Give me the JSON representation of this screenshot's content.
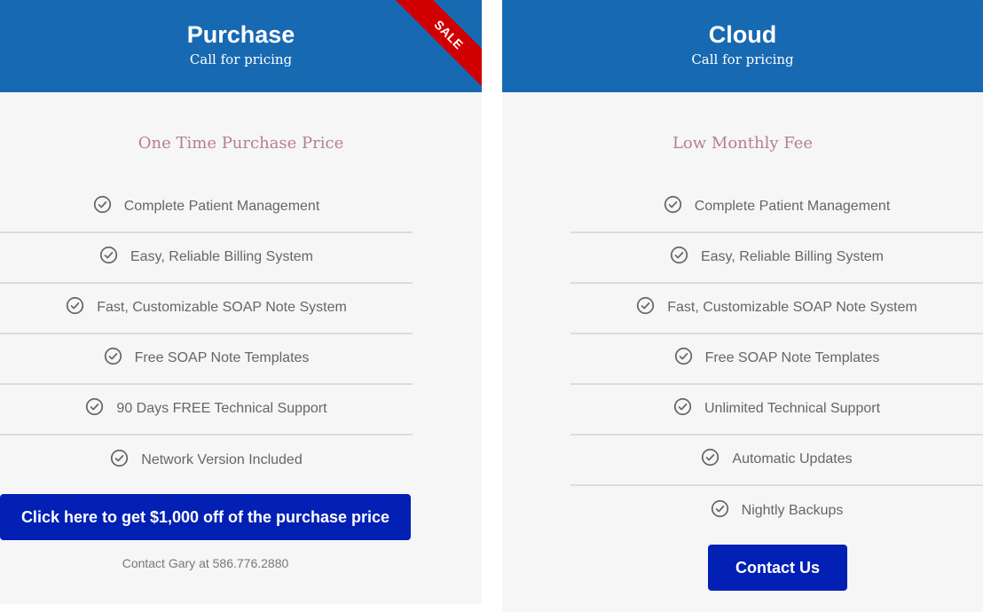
{
  "colors": {
    "header_bg": "#1769b2",
    "ribbon": "#d00000",
    "button_bg": "#0220b4",
    "subheading": "#b57d98",
    "card_bg": "#f6f6f6"
  },
  "plans": [
    {
      "title": "Purchase",
      "subtitle": "Call for pricing",
      "ribbon": "SALE",
      "subheading": "One Time Purchase Price",
      "features": [
        {
          "icon": "check-circle-icon",
          "label": "Complete Patient Management"
        },
        {
          "icon": "check-circle-icon",
          "label": "Easy, Reliable Billing System"
        },
        {
          "icon": "check-circle-icon",
          "label": "Fast, Customizable SOAP Note System"
        },
        {
          "icon": "check-circle-icon",
          "label": "Free SOAP Note Templates"
        },
        {
          "icon": "check-circle-icon",
          "label": "90 Days FREE Technical Support"
        },
        {
          "icon": "check-circle-icon",
          "label": "Network Version Included"
        }
      ],
      "button_label": "Click here to get $1,000 off of the purchase price",
      "note": "Contact Gary at 586.776.2880"
    },
    {
      "title": "Cloud",
      "subtitle": "Call for pricing",
      "ribbon": "",
      "subheading": "Low Monthly Fee",
      "features": [
        {
          "icon": "check-circle-icon",
          "label": "Complete Patient Management"
        },
        {
          "icon": "check-circle-icon",
          "label": "Easy, Reliable Billing System"
        },
        {
          "icon": "check-circle-icon",
          "label": "Fast, Customizable SOAP Note System"
        },
        {
          "icon": "check-circle-icon",
          "label": "Free SOAP Note Templates"
        },
        {
          "icon": "check-circle-icon",
          "label": "Unlimited Technical Support"
        },
        {
          "icon": "check-circle-icon",
          "label": "Automatic Updates"
        },
        {
          "icon": "check-circle-icon",
          "label": "Nightly Backups"
        }
      ],
      "button_label": "Contact Us"
    }
  ]
}
